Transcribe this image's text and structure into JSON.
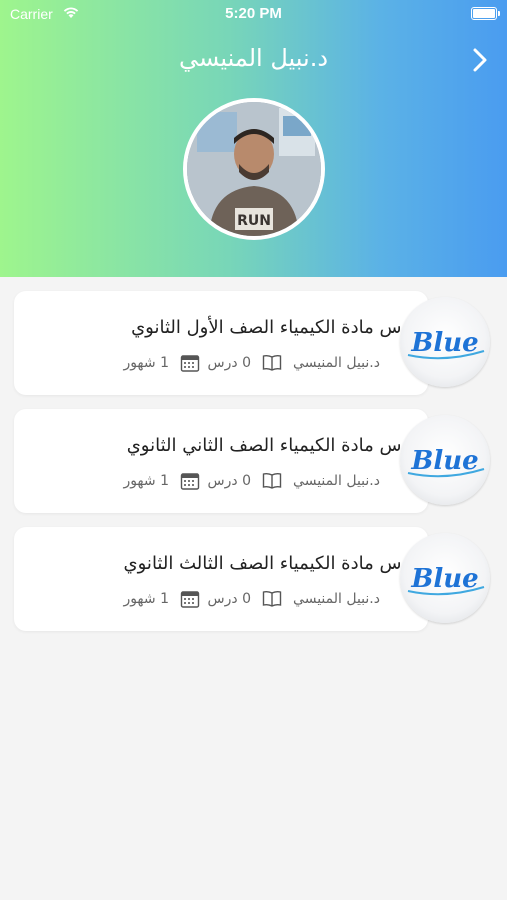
{
  "status_bar": {
    "carrier": "Carrier",
    "time": "5:20 PM"
  },
  "header": {
    "title": "د.نبيل المنيسي"
  },
  "colors": {
    "gradient_start": "#9ef58d",
    "gradient_end": "#4a9cf0",
    "background": "#f4f4f4",
    "card": "#ffffff",
    "logo_blue": "#1e73d6"
  },
  "courses": [
    {
      "title": "كورس مادة الكيمياء الصف الأول الثانوي",
      "instructor": "د.نبيل المنيسي",
      "lessons": "0 درس",
      "duration": "1 شهور",
      "thumb_text": "Blue"
    },
    {
      "title": "كورس مادة الكيمياء الصف الثاني الثانوي",
      "instructor": "د.نبيل المنيسي",
      "lessons": "0 درس",
      "duration": "1 شهور",
      "thumb_text": "Blue"
    },
    {
      "title": "كورس مادة الكيمياء الصف الثالث الثانوي",
      "instructor": "د.نبيل المنيسي",
      "lessons": "0 درس",
      "duration": "1 شهور",
      "thumb_text": "Blue"
    }
  ]
}
